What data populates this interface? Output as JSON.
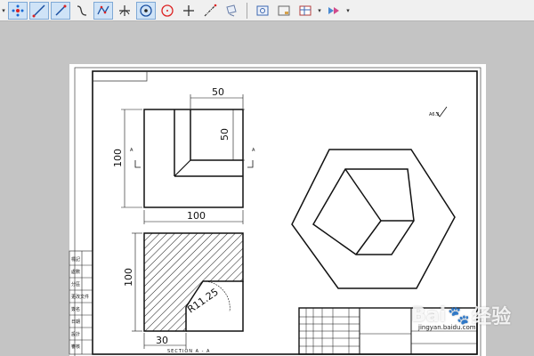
{
  "toolbar": {
    "groups": [
      [
        "drop-arrow",
        "snap-points-icon",
        "line-icon",
        "line-2-icon",
        "spline-icon",
        "polyline-icon",
        "trim-icon",
        "circle-center-icon",
        "circle-icon",
        "cross-icon",
        "centerline-icon",
        "note-icon"
      ],
      [
        "view-icon",
        "sheet-icon",
        "table-icon",
        "dropdown-arrow",
        "render-icon",
        "dropdown-arrow-2"
      ]
    ]
  },
  "drawing": {
    "dims": {
      "top_width": "50",
      "top_height": "50",
      "left_height": "100",
      "bottom_width": "100",
      "section_height": "100",
      "section_offset": "30",
      "radius": "R11.25"
    },
    "section_marker_left": "A",
    "section_marker_right": "A",
    "section_label": "SECTION A - A",
    "roughness_mark": "A6.3",
    "title_block_side_labels": [
      "標記",
      "處數",
      "分區",
      "更改文件",
      "簽名",
      "日期",
      "設計",
      "審核"
    ]
  },
  "watermark": {
    "brand": "Bai",
    "brand2": "经验",
    "sub": "jingyan.baidu.com"
  }
}
